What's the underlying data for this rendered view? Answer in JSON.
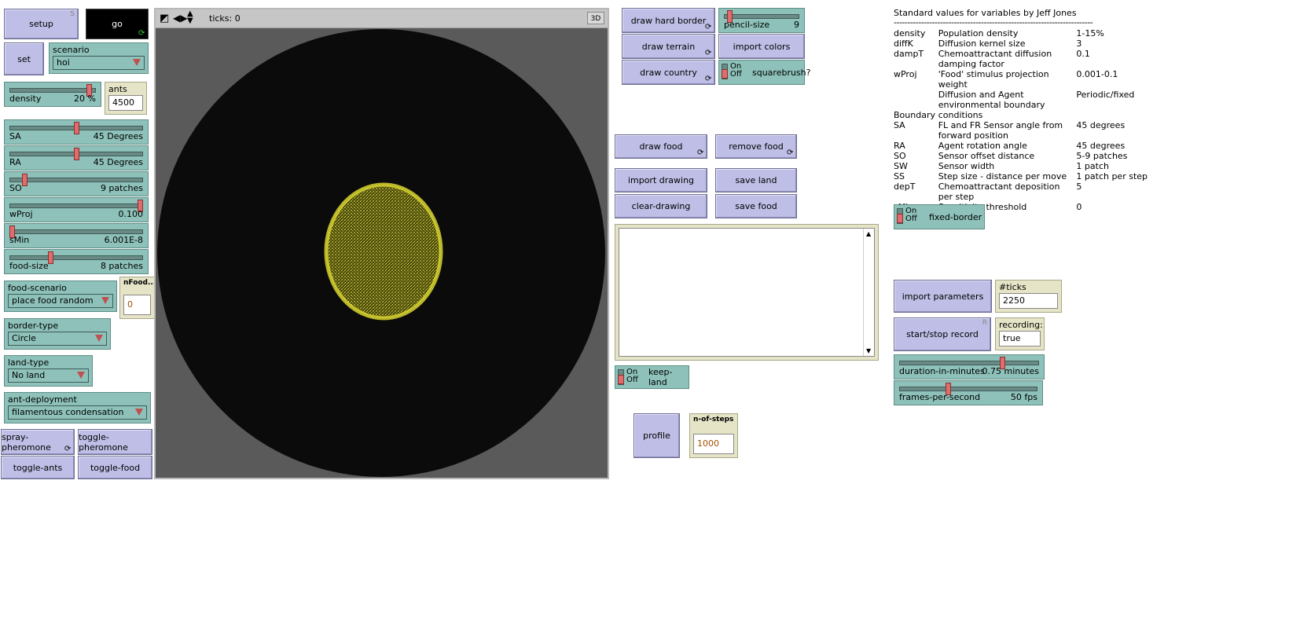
{
  "buttons": {
    "setup": {
      "label": "setup",
      "key": "S"
    },
    "go": {
      "label": "go"
    },
    "set": {
      "label": "set"
    },
    "spray_pheromone": {
      "label": "spray-pheromone"
    },
    "toggle_pheromone": {
      "label": "toggle-pheromone"
    },
    "toggle_ants": {
      "label": "toggle-ants"
    },
    "toggle_food": {
      "label": "toggle-food"
    },
    "draw_hard_border": {
      "label": "draw hard border"
    },
    "draw_terrain": {
      "label": "draw terrain"
    },
    "draw_country": {
      "label": "draw country"
    },
    "import_colors": {
      "label": "import colors"
    },
    "draw_food": {
      "label": "draw food"
    },
    "remove_food": {
      "label": "remove food"
    },
    "import_drawing": {
      "label": "import drawing"
    },
    "save_land": {
      "label": "save land"
    },
    "clear_drawing": {
      "label": "clear-drawing"
    },
    "save_food": {
      "label": "save food"
    },
    "profile": {
      "label": "profile"
    },
    "import_parameters": {
      "label": "import parameters"
    },
    "start_stop_record": {
      "label": "start/stop record",
      "key": "R"
    }
  },
  "choosers": {
    "scenario": {
      "label": "scenario",
      "value": "hoi"
    },
    "food_scenario": {
      "label": "food-scenario",
      "value": "place food random"
    },
    "border_type": {
      "label": "border-type",
      "value": "Circle"
    },
    "land_type": {
      "label": "land-type",
      "value": "No land"
    },
    "ant_deployment": {
      "label": "ant-deployment",
      "value": "filamentous condensation"
    }
  },
  "sliders": {
    "density": {
      "label": "density",
      "value": "20 %",
      "fraction": 0.95
    },
    "SA": {
      "label": "SA",
      "value": "45 Degrees",
      "fraction": 0.5
    },
    "RA": {
      "label": "RA",
      "value": "45 Degrees",
      "fraction": 0.5
    },
    "SO": {
      "label": "SO",
      "value": "9 patches",
      "fraction": 0.1
    },
    "wProj": {
      "label": "wProj",
      "value": "0.100",
      "fraction": 1.0
    },
    "sMin": {
      "label": "sMin",
      "value": "6.001E-8",
      "fraction": 0.0
    },
    "food_size": {
      "label": "food-size",
      "value": "8 patches",
      "fraction": 0.3
    },
    "pencil_size": {
      "label": "pencil-size",
      "value": "9",
      "fraction": 0.05
    },
    "duration": {
      "label": "duration-in-minutes",
      "value": "0.75 minutes",
      "fraction": 0.75
    },
    "fps": {
      "label": "frames-per-second",
      "value": "50 fps",
      "fraction": 0.35
    }
  },
  "inputs": {
    "ants": {
      "label": "ants",
      "value": "4500"
    },
    "nfood": {
      "label": "nFood...",
      "value": "0"
    },
    "n_of_steps": {
      "label": "n-of-steps",
      "value": "1000"
    },
    "ticks_recording": {
      "label": "#ticks recording:",
      "value": "2250"
    }
  },
  "monitors": {
    "recording": {
      "label": "recording:",
      "value": "true"
    }
  },
  "switches": {
    "squarebrush": {
      "label": "squarebrush?",
      "on": "On",
      "off": "Off"
    },
    "keep_land": {
      "label": "keep-land",
      "on": "On",
      "off": "Off"
    },
    "fixed_border": {
      "label": "fixed-border",
      "on": "On",
      "off": "Off"
    }
  },
  "view": {
    "ticks_label": "ticks: 0",
    "three_d": "3D"
  },
  "info": {
    "title": "Standard values for variables by Jeff Jones",
    "separator": "-------------------------------------------------------------------------",
    "rows": [
      {
        "var": "density",
        "desc": "Population density",
        "value": "1-15%"
      },
      {
        "var": "diffK",
        "desc": "Diffusion kernel size",
        "value": "3"
      },
      {
        "var": "dampT",
        "desc": "Chemoattractant diffusion damping factor",
        "value": "0.1"
      },
      {
        "var": "wProj",
        "desc": "'Food' stimulus projection weight",
        "value": "0.001-0.1"
      },
      {
        "var": "Boundary",
        "desc": "Diffusion and Agent environmental boundary conditions",
        "value": "Periodic/fixed"
      },
      {
        "var": "SA",
        "desc": "FL and FR Sensor angle from forward position",
        "value": "45 degrees"
      },
      {
        "var": "RA",
        "desc": "Agent rotation angle",
        "value": "45 degrees"
      },
      {
        "var": "SO",
        "desc": "Sensor offset distance",
        "value": "5-9 patches"
      },
      {
        "var": "SW",
        "desc": "Sensor width",
        "value": "1 patch"
      },
      {
        "var": "SS",
        "desc": "Step size - distance per move",
        "value": "1 patch per step"
      },
      {
        "var": "depT",
        "desc": "Chemoattractant deposition per step",
        "value": "5"
      },
      {
        "var": "sMin",
        "desc": "Sensitivity threshold",
        "value": "0"
      }
    ]
  }
}
